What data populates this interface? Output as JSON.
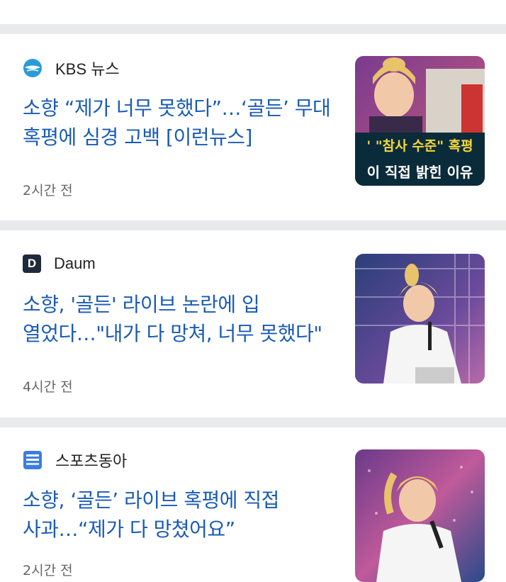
{
  "articles": [
    {
      "source": "KBS 뉴스",
      "source_icon": "kbs-logo-icon",
      "headline": "소향 “제가 너무 못했다”…‘골든’ 무대 혹평에 심경 고백 [이런뉴스]",
      "time": "2시간 전",
      "thumb_caption_1": "' \"참사 수준\" 혹평",
      "thumb_caption_2": "이 직접 밝힌 이유"
    },
    {
      "source": "Daum",
      "source_icon_letter": "D",
      "source_icon": "daum-logo-icon",
      "headline": "소향, '골든' 라이브 논란에 입 열었다…\"내가 다 망쳐, 너무 못했다\"",
      "time": "4시간 전"
    },
    {
      "source": "스포츠동아",
      "source_icon": "sports-donga-logo-icon",
      "headline": "소향, ‘골든’ 라이브 혹평에 직접 사과…“제가 다 망쳤어요”",
      "time": "2시간 전"
    }
  ],
  "colors": {
    "headline": "#1a5bb5",
    "separator": "#e9eaec",
    "kbs": "#2b9ad9",
    "daum": "#1f2a3a",
    "sports_donga": "#3b7ddd"
  }
}
